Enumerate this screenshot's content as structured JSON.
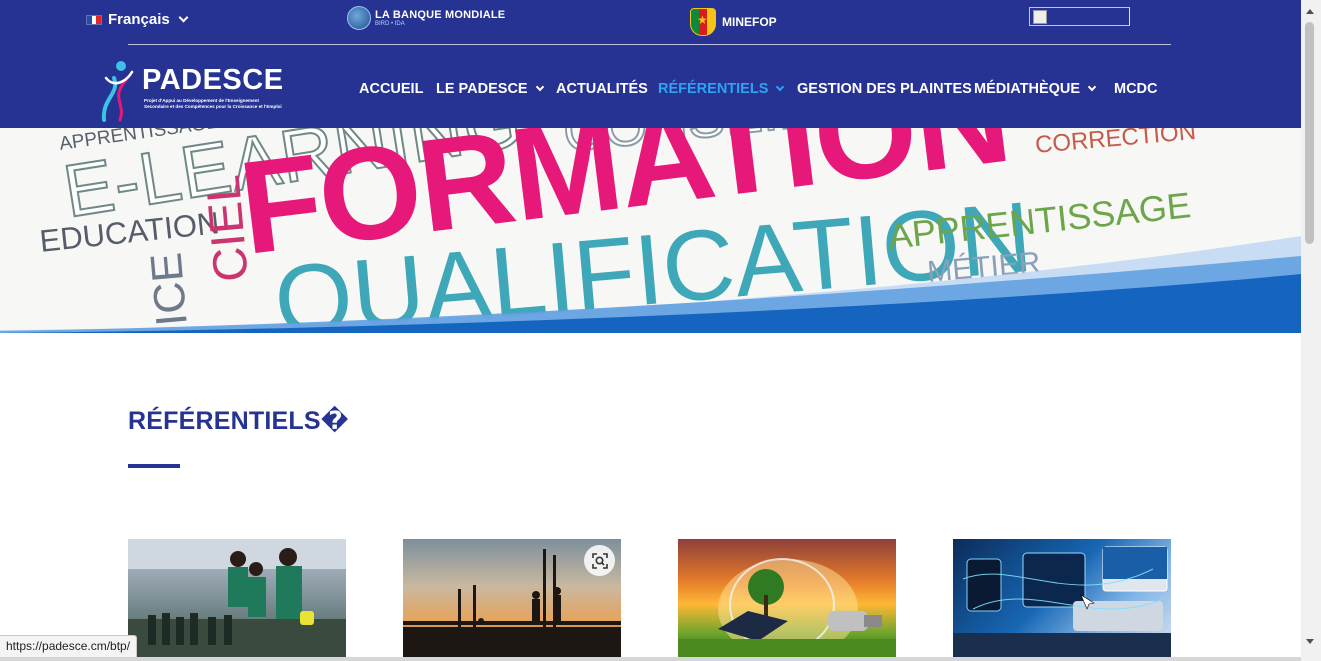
{
  "header": {
    "language": "Français",
    "partner_worldbank": "LA BANQUE MONDIALE",
    "partner_worldbank_sub": "BIRD • IDA",
    "partner_minefop": "MINEFOP",
    "logo_name": "PADESCE",
    "logo_tagline": "Projet d'Appui au Développement de l'Enseignement Secondaire et des Compétences pour la Croissance et l'Emploi"
  },
  "nav": {
    "items": [
      {
        "label": "ACCUEIL",
        "has_dropdown": false
      },
      {
        "label": "LE PADESCE",
        "has_dropdown": true
      },
      {
        "label": "ACTUALITÉS",
        "has_dropdown": false
      },
      {
        "label": "RÉFÉRENTIELS",
        "has_dropdown": true,
        "active": true
      },
      {
        "label": "GESTION DES PLAINTES",
        "has_dropdown": false
      },
      {
        "label": "MÉDIATHÈQUE",
        "has_dropdown": true
      },
      {
        "label": "MCDC",
        "has_dropdown": false
      }
    ]
  },
  "hero": {
    "words": [
      "FORMATION",
      "E-LEARNING",
      "APPRENTISSAGE",
      "EDUCATION",
      "CORRECTION",
      "APPRENTISSAGE",
      "MÉTIER",
      "QUALIFICATION",
      "CONSEIL",
      "CIEL",
      "ICE"
    ]
  },
  "main": {
    "title": "RÉFÉRENTIELS�"
  },
  "cards": [
    {
      "subject": "women-workers-lab"
    },
    {
      "subject": "construction-silhouettes"
    },
    {
      "subject": "energy-lightbulb"
    },
    {
      "subject": "digital-devices"
    }
  ],
  "status_bar": {
    "url": "https://padesce.cm/btp/"
  },
  "colors": {
    "header_bg": "#263393",
    "active_nav": "#2ea3f2",
    "title": "#263393",
    "accent_pink": "#e6197a",
    "wave_blue": "#1565c0"
  },
  "icons": {
    "language_chevron": "chevron-down-icon",
    "zoom": "zoom-lens-icon",
    "flag": "france-flag-icon"
  }
}
